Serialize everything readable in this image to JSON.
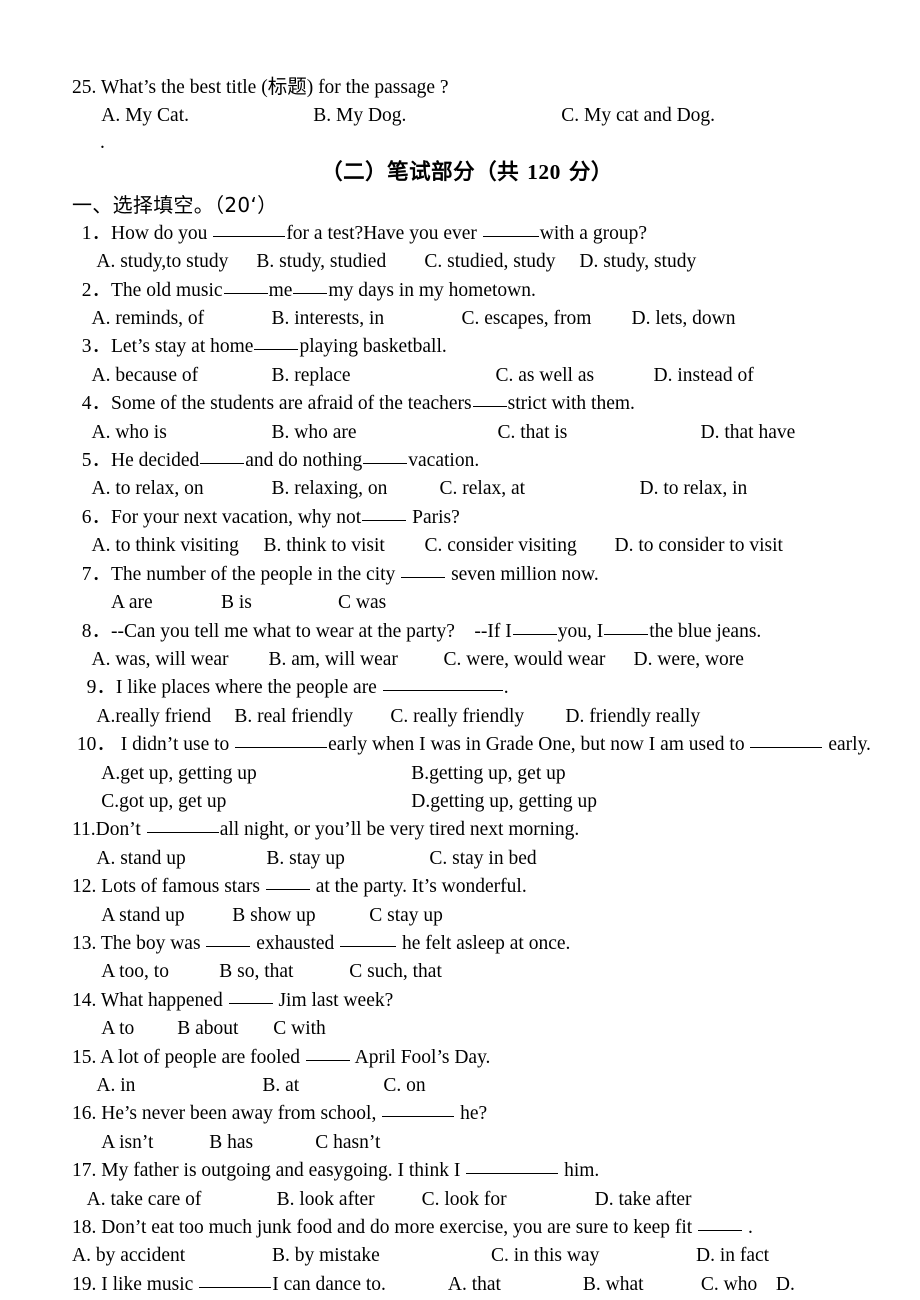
{
  "document": {
    "type": "exam-paper",
    "language": "en-zh",
    "prev_question": {
      "number": "25.",
      "text": "What’s the best title (标题) for the passage ?",
      "options": [
        "A. My Cat.",
        "B. My Dog.",
        "C. My cat and Dog."
      ]
    },
    "stray_mark": ".",
    "part_title": {
      "prefix": "（二）笔试部分",
      "score_open": "（共 ",
      "score_value": "120",
      "score_close": " 分）"
    },
    "section_heading": "一、选择填空。（20‘）",
    "questions": [
      {
        "number": "1．",
        "stem_a": "How do you ",
        "stem_b": "for a test?Have you ever ",
        "stem_c": "with a group?",
        "options": [
          "A. study,to study",
          "B. study, studied",
          "C. studied, study",
          "D. study, study"
        ]
      },
      {
        "number": "2．",
        "stem_a": "The old music",
        "stem_b": "me",
        "stem_c": "my days in my hometown.",
        "options": [
          "A. reminds, of",
          "B. interests, in",
          "C. escapes, from",
          "D. lets, down"
        ]
      },
      {
        "number": "3．",
        "stem_a": "Let’s stay at home",
        "stem_b": "playing basketball.",
        "options": [
          "A. because of",
          "B. replace",
          "C. as well as",
          "D. instead of"
        ]
      },
      {
        "number": "4．",
        "stem_a": "Some of the students are afraid of the teachers",
        "stem_b": "strict with them.",
        "options": [
          "A. who is",
          "B. who are",
          "C. that is",
          "D. that have"
        ]
      },
      {
        "number": "5．",
        "stem_a": "He decided",
        "stem_b": "and do nothing",
        "stem_c": "vacation.",
        "options": [
          "A. to relax, on",
          "B. relaxing, on",
          "C. relax, at",
          "D. to relax, in"
        ]
      },
      {
        "number": "6．",
        "stem_a": "For your next vacation, why not",
        "stem_b": " Paris?",
        "options": [
          "A. to think visiting",
          "B. think to visit",
          "C. consider visiting",
          "D. to consider to visit"
        ]
      },
      {
        "number": "7．",
        "stem_a": "The number of the people in the city ",
        "stem_b": " seven million now.",
        "options": [
          "A are",
          "B is",
          "C was"
        ]
      },
      {
        "number": "8．",
        "stem_a": "--Can you tell me what to wear at the party?    --If I",
        "stem_b": "you, I",
        "stem_c": "the blue jeans.",
        "options": [
          "A. was, will wear",
          "B. am, will wear",
          "C. were, would wear",
          "D. were, wore"
        ]
      },
      {
        "number": "9．",
        "stem_a": "I like places where the people are ",
        "stem_b": ".",
        "options": [
          "A.really friend",
          "B. real friendly",
          "C. really friendly",
          "D. friendly really"
        ]
      },
      {
        "number": "10．",
        "stem_a": "I didn’t use to ",
        "stem_b": "early when I was in Grade One, but now I am used to ",
        "stem_c": " early.",
        "options": [
          "A.get up, getting up",
          "B.getting up, get up",
          "C.got up, get up",
          "D.getting up, getting up"
        ]
      },
      {
        "number": "11.",
        "stem_a": "Don’t ",
        "stem_b": "all night, or you’ll be very tired next morning.",
        "options": [
          "A. stand up",
          "B. stay up",
          "C. stay in bed"
        ]
      },
      {
        "number": "12.",
        "stem_a": " Lots of famous stars ",
        "stem_b": " at the party. It’s wonderful.",
        "options": [
          "A stand up",
          "B show up",
          "C stay up"
        ]
      },
      {
        "number": "13.",
        "stem_a": " The boy was ",
        "stem_b": " exhausted ",
        "stem_c": " he felt asleep at once.",
        "options": [
          "A too, to",
          "B so, that",
          "C such, that"
        ]
      },
      {
        "number": "14.",
        "stem_a": " What happened ",
        "stem_b": " Jim last week?",
        "options": [
          "A to",
          "B about",
          "C with"
        ]
      },
      {
        "number": "15.",
        "stem_a": " A lot of people are fooled ",
        "stem_b": " April Fool’s Day.",
        "options": [
          "A. in",
          "B. at",
          "C. on"
        ]
      },
      {
        "number": "16.",
        "stem_a": " He’s never been away from school, ",
        "stem_b": " he?",
        "options": [
          "A isn’t",
          "B has",
          "C hasn’t"
        ]
      },
      {
        "number": "17.",
        "stem_a": " My father is outgoing and easygoing. I think I ",
        "stem_b": " him.",
        "options": [
          "A. take care of",
          "B. look after",
          "C. look for",
          "D. take after"
        ]
      },
      {
        "number": "18.",
        "stem_a": " Don’t eat too much junk food and do more exercise, you are sure to keep fit ",
        "stem_b": " .",
        "options": [
          "A. by accident",
          "B. by mistake",
          "C. in this way",
          "D. in fact"
        ]
      },
      {
        "number": "19.",
        "stem_a": " I like music ",
        "stem_b": "I can dance to.",
        "inline_options": [
          "A. that",
          "B. what",
          "C. who",
          "D."
        ]
      }
    ]
  }
}
